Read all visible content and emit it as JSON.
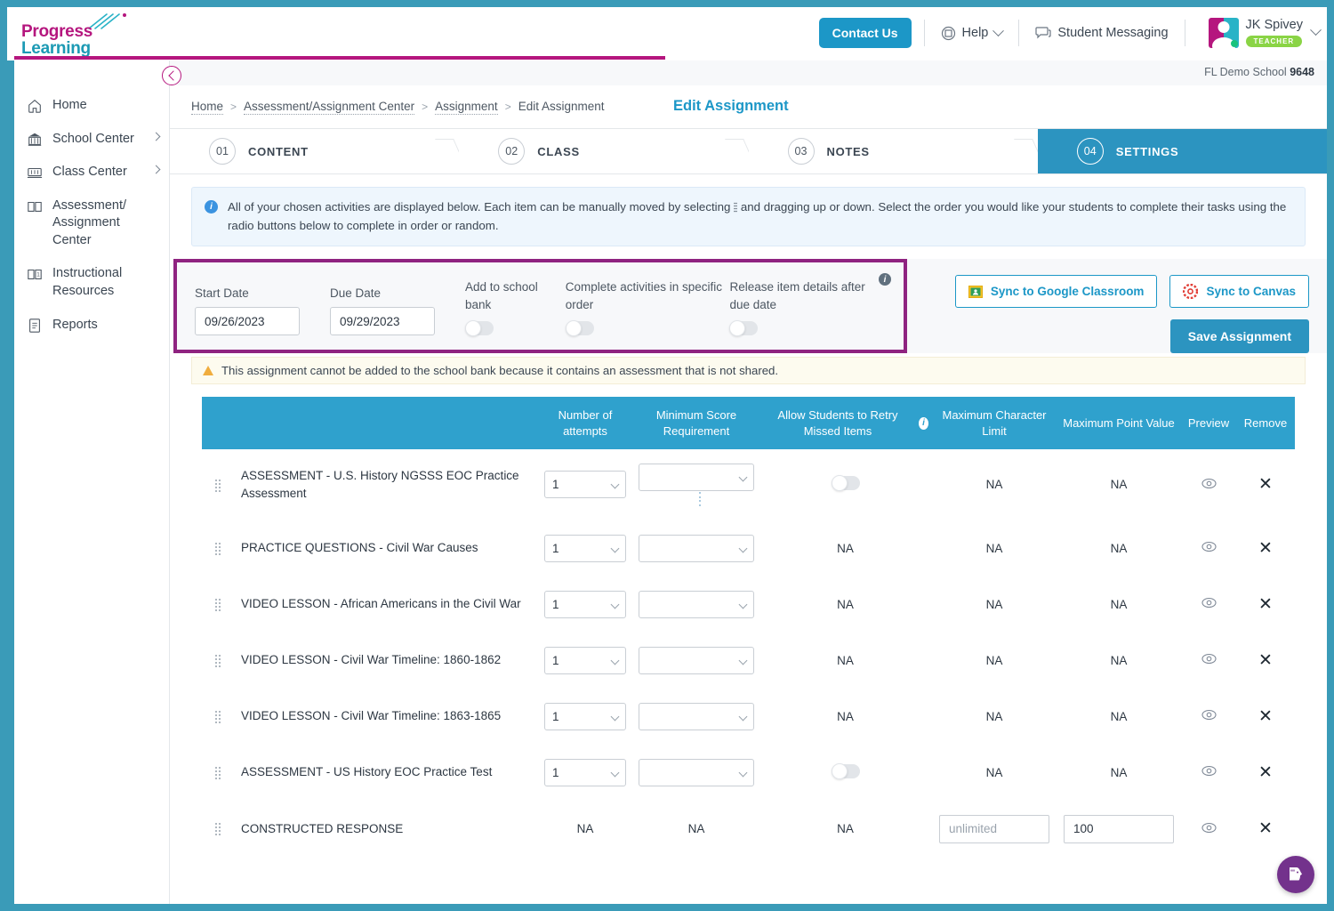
{
  "brand": {
    "line1": "Progress",
    "line2": "Learning",
    "color_primary": "#b5167e",
    "color_secondary": "#1c9ab4"
  },
  "header": {
    "contact_label": "Contact Us",
    "help_label": "Help",
    "messaging_label": "Student Messaging",
    "user_name": "JK Spivey",
    "user_role": "TEACHER"
  },
  "school": {
    "name": "FL Demo School",
    "id": "9648"
  },
  "sidebar": {
    "items": [
      {
        "label": "Home",
        "icon": "home-icon",
        "has_arrow": false
      },
      {
        "label": "School Center",
        "icon": "school-icon",
        "has_arrow": true
      },
      {
        "label": "Class Center",
        "icon": "class-icon",
        "has_arrow": true
      },
      {
        "label": "Assessment/ Assignment Center",
        "icon": "book-icon",
        "has_arrow": false
      },
      {
        "label": "Instructional Resources",
        "icon": "resources-icon",
        "has_arrow": false
      },
      {
        "label": "Reports",
        "icon": "report-icon",
        "has_arrow": false
      }
    ]
  },
  "breadcrumb": {
    "items": [
      "Home",
      "Assessment/Assignment Center",
      "Assignment",
      "Edit Assignment"
    ],
    "separator": ">"
  },
  "page_title": "Edit Assignment",
  "stepper": {
    "steps": [
      {
        "num": "01",
        "label": "CONTENT",
        "active": false
      },
      {
        "num": "02",
        "label": "CLASS",
        "active": false
      },
      {
        "num": "03",
        "label": "NOTES",
        "active": false
      },
      {
        "num": "04",
        "label": "SETTINGS",
        "active": true
      }
    ]
  },
  "info_banner": {
    "part1": "All of your chosen activities are displayed below. Each item can be manually moved by selecting",
    "part2": "and dragging up or down. Select the order you would like your students to complete their tasks using the radio buttons below to complete in order or random."
  },
  "settings": {
    "start_date_label": "Start Date",
    "start_date_value": "09/26/2023",
    "due_date_label": "Due Date",
    "due_date_value": "09/29/2023",
    "toggles": [
      {
        "label": "Add to school bank",
        "on": false
      },
      {
        "label": "Complete activities in specific order",
        "on": false
      },
      {
        "label": "Release item details after due date",
        "on": false
      }
    ],
    "sync_google_label": "Sync to Google Classroom",
    "sync_canvas_label": "Sync to Canvas",
    "save_label": "Save Assignment"
  },
  "warning": "This assignment cannot be added to the school bank because it contains an assessment that is not shared.",
  "table": {
    "headers": [
      "",
      "Number of attempts",
      "Minimum Score Requirement",
      "Allow Students to Retry Missed Items",
      "Maximum Character Limit",
      "Maximum Point Value",
      "Preview",
      "Remove"
    ],
    "rows": [
      {
        "name": "ASSESSMENT - U.S. History NGSSS EOC Practice Assessment",
        "attempts": "1",
        "attempts_type": "select",
        "min_score": "",
        "min_score_type": "select",
        "extra_dots": true,
        "retry": "toggle",
        "retry_on": false,
        "char_limit": "NA",
        "char_limit_type": "text",
        "point_value": "NA",
        "point_value_type": "text"
      },
      {
        "name": "PRACTICE QUESTIONS - Civil War Causes",
        "attempts": "1",
        "attempts_type": "select",
        "min_score": "",
        "min_score_type": "select",
        "extra_dots": false,
        "retry": "NA",
        "retry_on": false,
        "char_limit": "NA",
        "char_limit_type": "text",
        "point_value": "NA",
        "point_value_type": "text"
      },
      {
        "name": "VIDEO LESSON - African Americans in the Civil War",
        "attempts": "1",
        "attempts_type": "select",
        "min_score": "",
        "min_score_type": "select",
        "extra_dots": false,
        "retry": "NA",
        "retry_on": false,
        "char_limit": "NA",
        "char_limit_type": "text",
        "point_value": "NA",
        "point_value_type": "text"
      },
      {
        "name": "VIDEO LESSON - Civil War Timeline: 1860-1862",
        "attempts": "1",
        "attempts_type": "select",
        "min_score": "",
        "min_score_type": "select",
        "extra_dots": false,
        "retry": "NA",
        "retry_on": false,
        "char_limit": "NA",
        "char_limit_type": "text",
        "point_value": "NA",
        "point_value_type": "text"
      },
      {
        "name": "VIDEO LESSON - Civil War Timeline: 1863-1865",
        "attempts": "1",
        "attempts_type": "select",
        "min_score": "",
        "min_score_type": "select",
        "extra_dots": false,
        "retry": "NA",
        "retry_on": false,
        "char_limit": "NA",
        "char_limit_type": "text",
        "point_value": "NA",
        "point_value_type": "text"
      },
      {
        "name": "ASSESSMENT - US History EOC Practice Test",
        "attempts": "1",
        "attempts_type": "select",
        "min_score": "",
        "min_score_type": "select",
        "extra_dots": false,
        "retry": "toggle",
        "retry_on": false,
        "char_limit": "NA",
        "char_limit_type": "text",
        "point_value": "NA",
        "point_value_type": "text"
      },
      {
        "name": "CONSTRUCTED RESPONSE",
        "attempts": "NA",
        "attempts_type": "text",
        "min_score": "NA",
        "min_score_type": "text",
        "extra_dots": false,
        "retry": "NA",
        "retry_on": false,
        "char_limit": "",
        "char_limit_placeholder": "unlimited",
        "char_limit_type": "input",
        "point_value": "100",
        "point_value_type": "input"
      }
    ]
  },
  "chat": {
    "label": "chat-widget"
  }
}
